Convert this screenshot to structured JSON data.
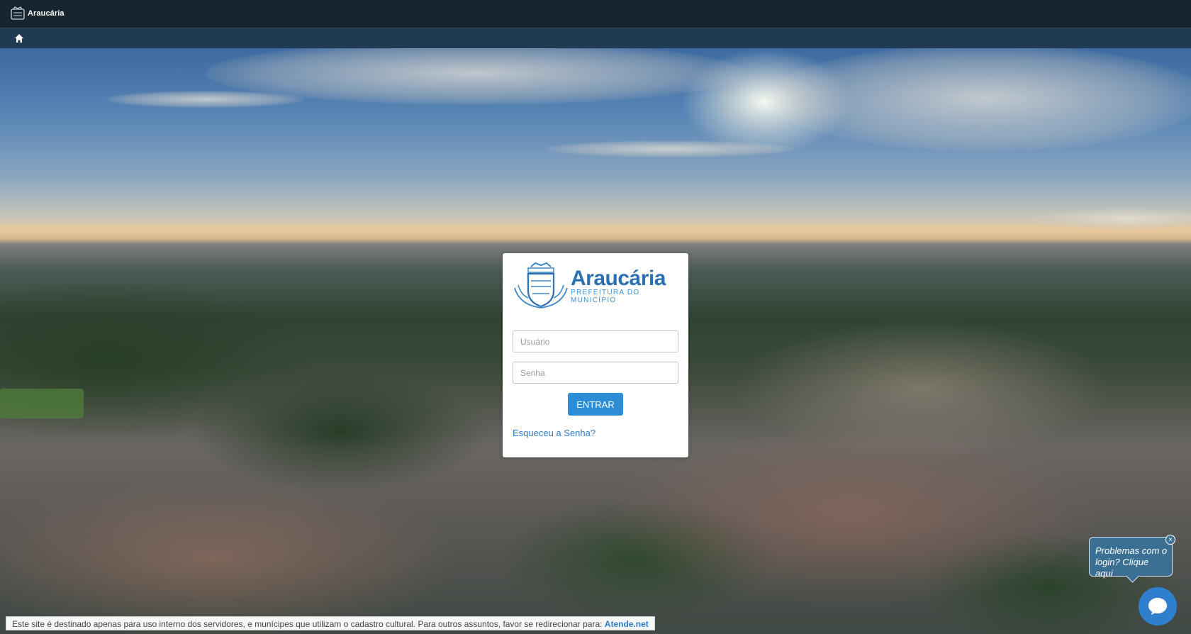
{
  "topbar": {
    "brand_text": "Araucária"
  },
  "login": {
    "logo_name": "Araucária",
    "logo_subtitle": "PREFEITURA DO MUNICÍPIO",
    "username_placeholder": "Usuário",
    "password_placeholder": "Senha",
    "submit_label": "ENTRAR",
    "forgot_link": "Esqueceu a Senha?"
  },
  "help": {
    "bubble_line1": "Problemas com o",
    "bubble_line2": "login? Clique aqui",
    "close_symbol": "×"
  },
  "notice": {
    "text": "Este site é destinado apenas para uso interno dos servidores, e munícipes que utilizam o cadastro cultural. Para outros assuntos, favor se redirecionar para:",
    "link_text": "Atende.net"
  },
  "colors": {
    "topbar": "#18252f",
    "navbar": "#1f3a52",
    "accent": "#2c8cd6",
    "brand_blue": "#2d6fb3"
  },
  "icons": [
    "home-icon",
    "seal-icon",
    "chat-icon",
    "close-icon"
  ]
}
